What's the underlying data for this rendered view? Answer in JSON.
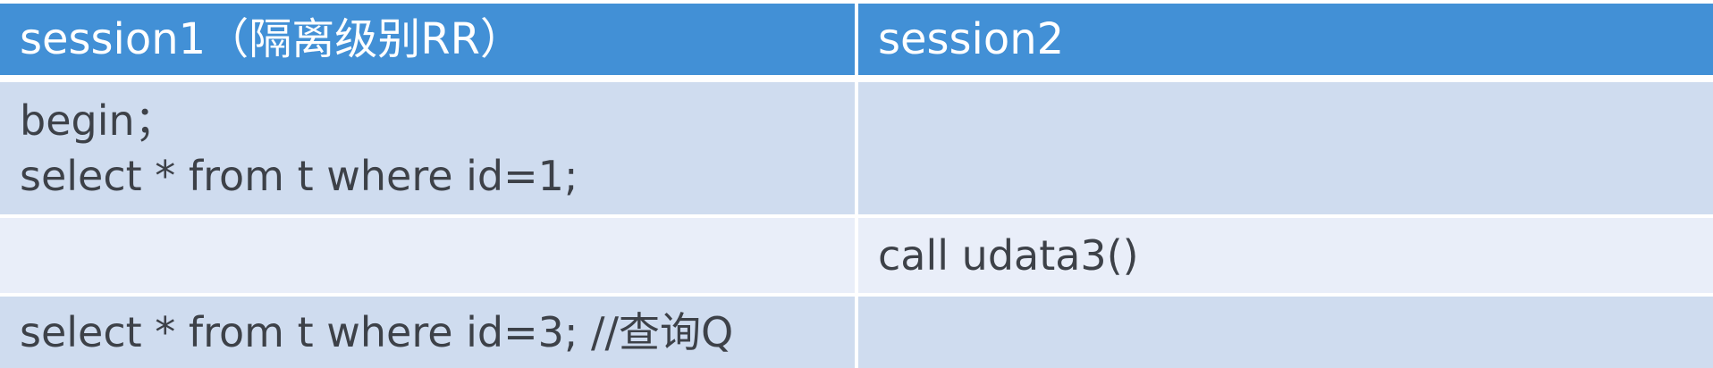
{
  "table": {
    "headers": [
      "session1（隔离级别RR）",
      "session2"
    ],
    "rows": [
      {
        "session1": [
          "begin；",
          "select * from t where id=1;"
        ],
        "session2": [
          ""
        ]
      },
      {
        "session1": [
          ""
        ],
        "session2": [
          "call udata3()"
        ]
      },
      {
        "session1": [
          "select * from t where id=3; //查询Q"
        ],
        "session2": [
          ""
        ]
      }
    ]
  },
  "colors": {
    "header_bg": "#4290d6",
    "row_dark_bg": "#cfdcef",
    "row_light_bg": "#e9eef9",
    "text": "#3d4148"
  }
}
